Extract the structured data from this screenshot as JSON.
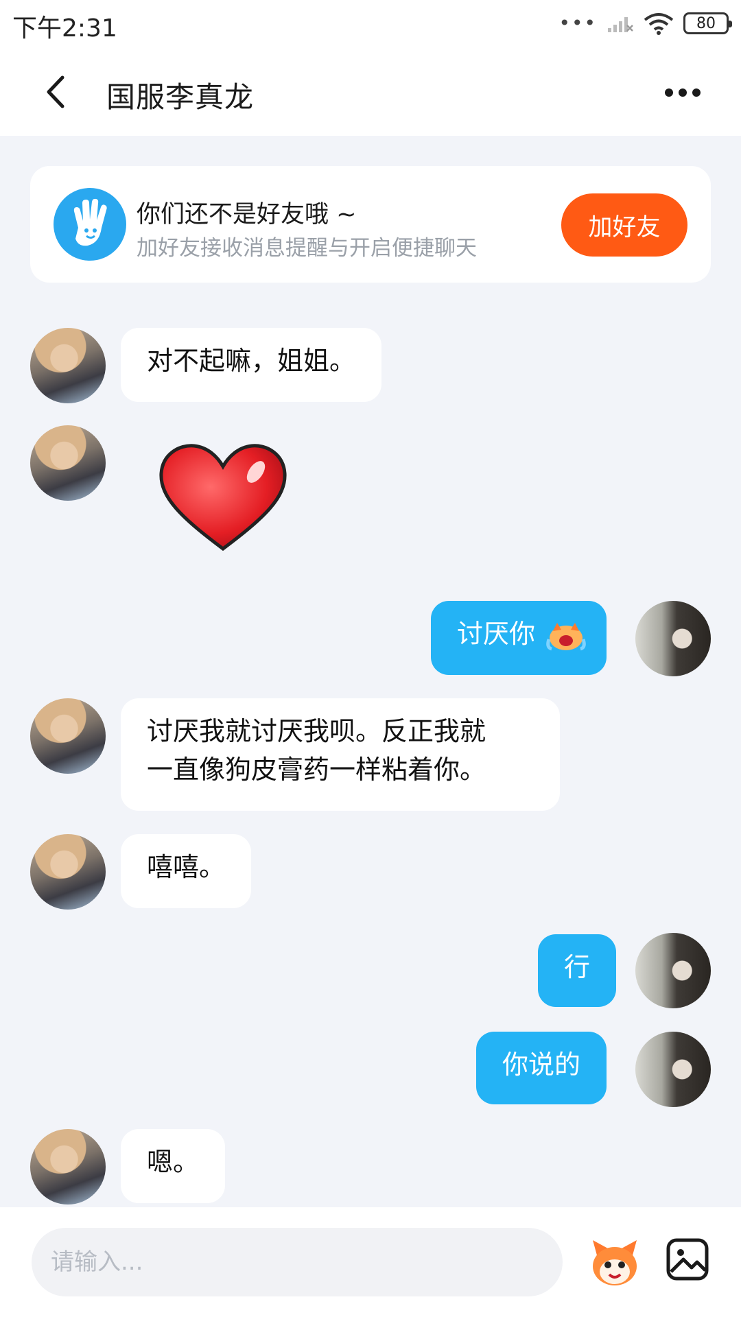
{
  "status_bar": {
    "time": "下午2:31",
    "signal_dots": "•••",
    "battery": "80"
  },
  "header": {
    "title": "国服李真龙",
    "back_icon": "chevron-left-icon",
    "more_icon": "more-dots-icon"
  },
  "friend_banner": {
    "title": "你们还不是好友哦 ~",
    "subtitle": "加好友接收消息提醒与开启便捷聊天",
    "button_label": "加好友",
    "icon": "hand-wave-icon"
  },
  "messages": [
    {
      "from": "them",
      "text": "对不起嘛，姐姐。"
    },
    {
      "from": "them",
      "sticker": "red-heart-sticker"
    },
    {
      "from": "me",
      "text": "讨厌你",
      "emoji": "crying-emoji"
    },
    {
      "from": "them",
      "line1": "讨厌我就讨厌我呗。反正我就",
      "line2": "一直像狗皮膏药一样粘着你。"
    },
    {
      "from": "them",
      "text": "嘻嘻。"
    },
    {
      "from": "me",
      "text": "行"
    },
    {
      "from": "me",
      "text": "你说的"
    },
    {
      "from": "them",
      "text": "嗯。"
    }
  ],
  "input_bar": {
    "placeholder": "请输入...",
    "emoji_icon": "mascot-emoji-icon",
    "image_icon": "image-picker-icon"
  },
  "colors": {
    "accent_blue": "#24b3f5",
    "add_friend_orange": "#ff5a14",
    "background": "#f2f4f9"
  }
}
